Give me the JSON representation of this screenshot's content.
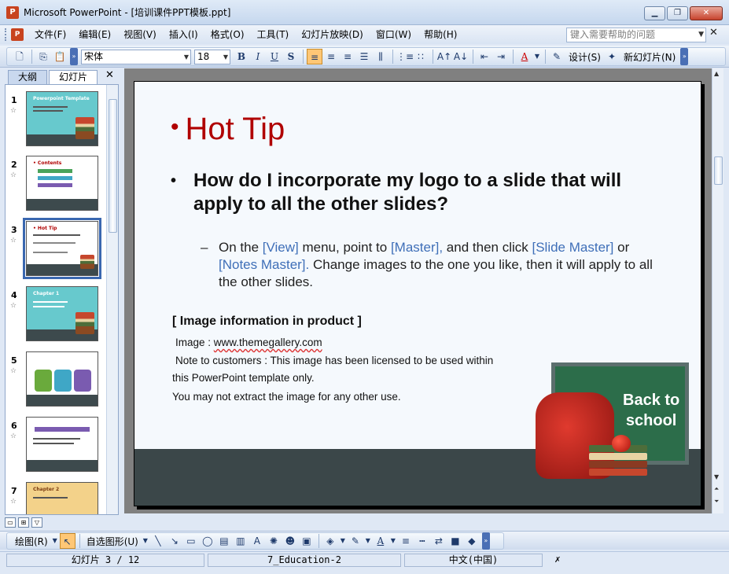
{
  "window": {
    "title": "Microsoft PowerPoint - [培训课件PPT模板.ppt]",
    "app_icon": "P"
  },
  "menu": {
    "items": [
      "文件(F)",
      "编辑(E)",
      "视图(V)",
      "插入(I)",
      "格式(O)",
      "工具(T)",
      "幻灯片放映(D)",
      "窗口(W)",
      "帮助(H)"
    ],
    "help_placeholder": "键入需要帮助的问题"
  },
  "toolbar": {
    "font": "宋体",
    "size": "18",
    "design_label": "设计(S)",
    "new_slide_label": "新幻灯片(N)"
  },
  "pane": {
    "tab_outline": "大纲",
    "tab_slides": "幻灯片",
    "thumbnails": [
      {
        "num": "1",
        "title": "Powerpoint Template"
      },
      {
        "num": "2",
        "title": "• Contents"
      },
      {
        "num": "3",
        "title": "• Hot Tip"
      },
      {
        "num": "4",
        "title": "Chapter 1"
      },
      {
        "num": "5",
        "title": ""
      },
      {
        "num": "6",
        "title": ""
      },
      {
        "num": "7",
        "title": "Chapter 2"
      }
    ]
  },
  "slide": {
    "title": "Hot Tip",
    "subtitle": "How do I incorporate my logo to a slide that will apply to all the other slides?",
    "body_pre": "On the ",
    "body_view": "[View]",
    "body_mid1": " menu, point to ",
    "body_master": "[Master],",
    "body_mid2": " and then click ",
    "body_slide_master": "[Slide Master]",
    "body_or": " or ",
    "body_notes_master": "[Notes Master].",
    "body_post": " Change images to the one you like, then it will apply to all the other slides.",
    "info_head": "[ Image information in product ]",
    "info_image_label": "Image : ",
    "info_image_url": "www.themegallery.com",
    "info_note1": "Note to customers : This image has been licensed to be used within",
    "info_note2": "this PowerPoint template only.",
    "info_note3": "You may not extract the image for any other use.",
    "board_line1": "Back to",
    "board_line2": "school"
  },
  "drawing": {
    "draw_label": "绘图(R)",
    "autoshape_label": "自选图形(U)"
  },
  "status": {
    "slide": "幻灯片 3 / 12",
    "design": "7_Education-2",
    "language": "中文(中国)"
  }
}
